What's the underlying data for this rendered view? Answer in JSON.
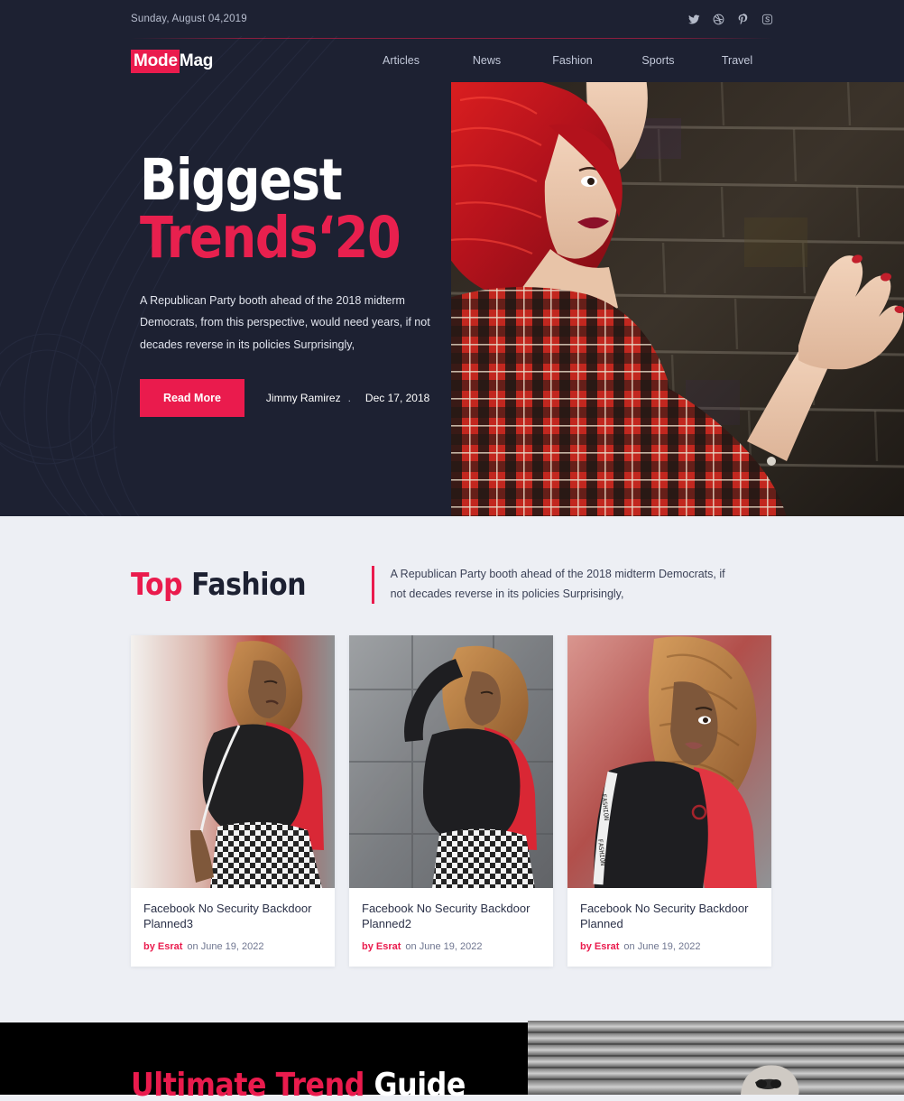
{
  "topbar": {
    "date": "Sunday, August 04,2019",
    "socials": [
      {
        "name": "twitter-icon",
        "label": "Twitter"
      },
      {
        "name": "dribbble-icon",
        "label": "Dribbble"
      },
      {
        "name": "pinterest-icon",
        "label": "Pinterest"
      },
      {
        "name": "skype-icon",
        "label": "Skype"
      }
    ]
  },
  "brand": {
    "part1": "Mode",
    "part2": "Mag"
  },
  "nav": {
    "items": [
      {
        "label": "Articles"
      },
      {
        "label": "News"
      },
      {
        "label": "Fashion"
      },
      {
        "label": "Sports"
      },
      {
        "label": "Travel"
      }
    ]
  },
  "hero": {
    "title_line1": "Biggest",
    "title_line2": "Trends‘20",
    "paragraph": "A Republican Party booth ahead of the 2018 midterm Democrats, from this perspective, would need years, if not decades reverse in its policies Surprisingly,",
    "button": "Read More",
    "author": "Jimmy Ramirez",
    "separator": ".",
    "date": "Dec 17, 2018",
    "image_alt": "Woman with red hair in red plaid shirt leaning against a dark brick wall"
  },
  "top_fashion": {
    "title_red": "Top",
    "title_dark": "Fashion",
    "subtitle": "A Republican Party booth ahead of the 2018 midterm Democrats, if not decades reverse in its policies Surprisingly,",
    "cards": [
      {
        "title": "Facebook No Security Backdoor Planned3",
        "by": "by Esrat",
        "on": "on June 19, 2022",
        "image_alt": "Woman in black bomber jacket with red lining and gingham trousers against red wall"
      },
      {
        "title": "Facebook No Security Backdoor Planned2",
        "by": "by Esrat",
        "on": "on June 19, 2022",
        "image_alt": "Woman posing with hand in hair wearing black and red jacket by grey wall"
      },
      {
        "title": "Facebook No Security Backdoor Planned",
        "by": "by Esrat",
        "on": "on June 19, 2022",
        "image_alt": "Close-up of woman with curly hair in black jacket over red shirt"
      }
    ]
  },
  "bottom_banner": {
    "title_red": "Ultimate Trend",
    "title_white": "Guide",
    "image_alt": "Grayscale photo of corrugated metal shutter with person wearing sunglasses"
  },
  "colors": {
    "accent": "#ea1b4d",
    "dark": "#1d2132",
    "page_bg": "#edeff4",
    "card_bg": "#ffffff",
    "black": "#000000"
  }
}
